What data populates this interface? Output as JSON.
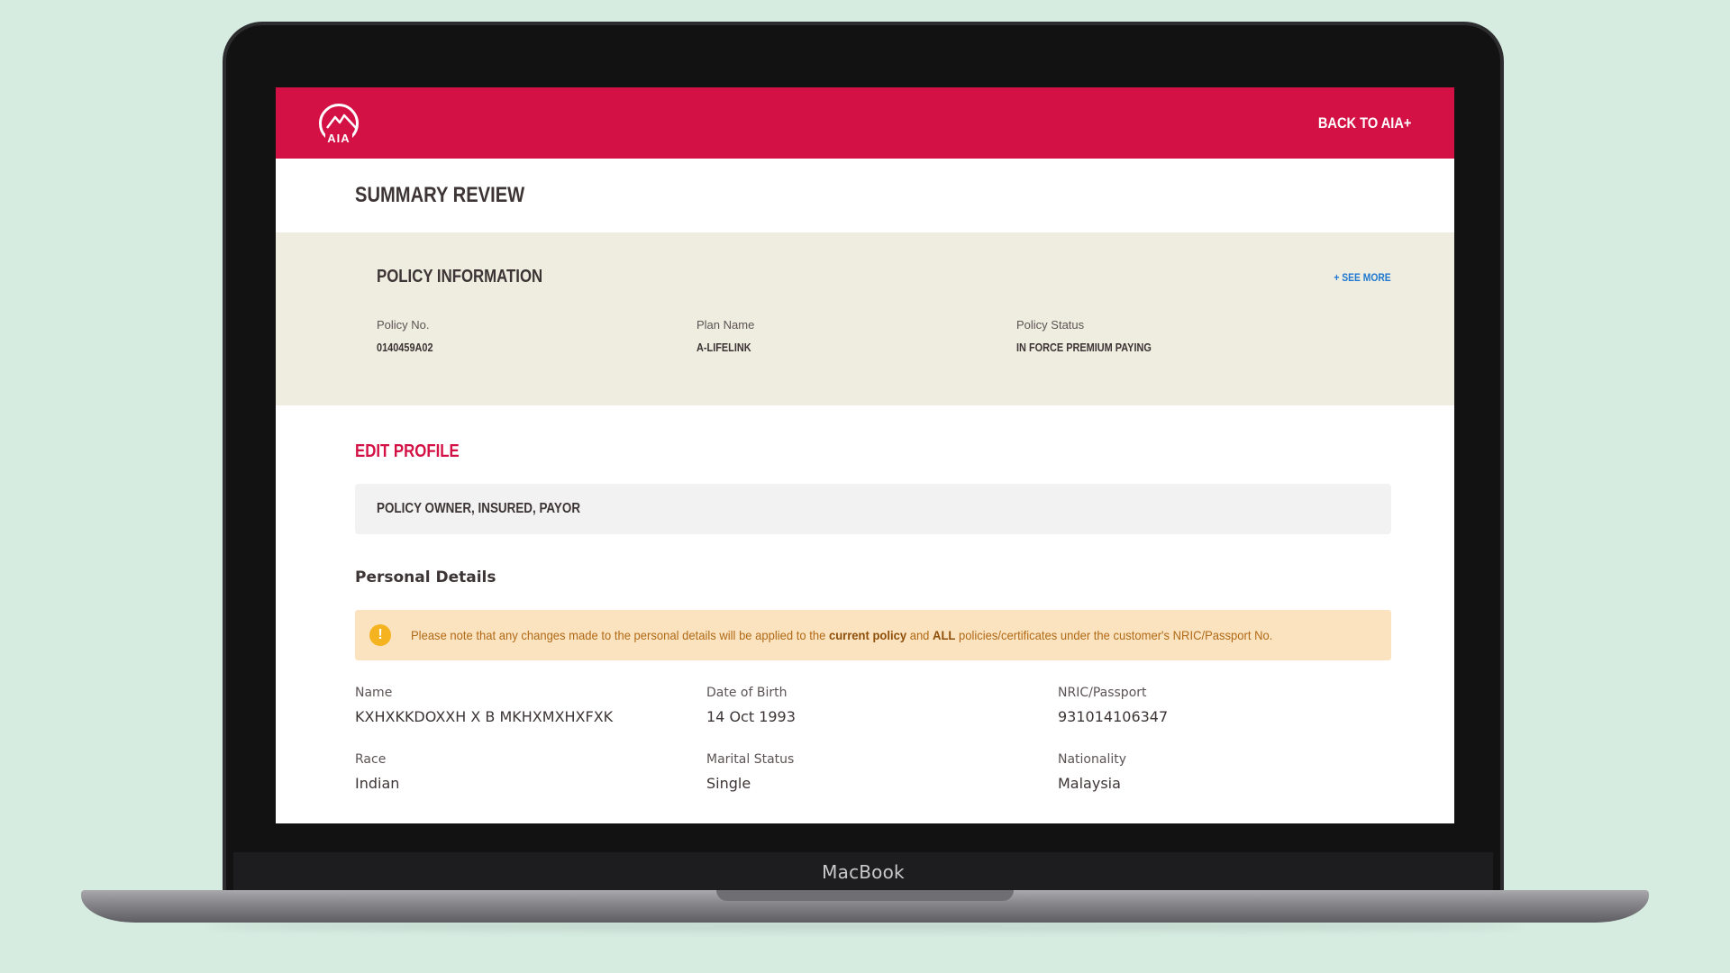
{
  "device": {
    "label": "MacBook"
  },
  "header": {
    "logo_text": "AIA",
    "back_link": "BACK TO AIA+"
  },
  "page": {
    "title": "SUMMARY REVIEW"
  },
  "policy_info": {
    "title": "POLICY INFORMATION",
    "see_more": "+ SEE MORE",
    "fields": [
      {
        "label": "Policy No.",
        "value": "0140459A02"
      },
      {
        "label": "Plan Name",
        "value": "A-LIFELINK"
      },
      {
        "label": "Policy Status",
        "value": "IN FORCE PREMIUM PAYING"
      }
    ]
  },
  "edit_profile": {
    "title": "EDIT PROFILE",
    "roles": "POLICY OWNER, INSURED, PAYOR",
    "section_title": "Personal Details",
    "notice": {
      "icon": "exclamation-icon",
      "text_before": "Please note that any changes made to the personal details will be applied to the ",
      "bold_1": "current policy",
      "text_mid": " and ",
      "bold_2": "ALL",
      "text_after": " policies/certificates under the customer's NRIC/Passport No."
    },
    "details": [
      {
        "label": "Name",
        "value": "KXHXKKDOXXH X B MKHXMXHXFXK"
      },
      {
        "label": "Date of Birth",
        "value": "14 Oct 1993"
      },
      {
        "label": "NRIC/Passport",
        "value": "931014106347"
      },
      {
        "label": "Race",
        "value": "Indian"
      },
      {
        "label": "Marital Status",
        "value": "Single"
      },
      {
        "label": "Nationality",
        "value": "Malaysia"
      }
    ]
  },
  "colors": {
    "brand_red": "#d31145",
    "panel_beige": "#efece0",
    "notice_bg": "#fbe3bf",
    "link_blue": "#1f78d1",
    "background": "#d6ece1"
  }
}
